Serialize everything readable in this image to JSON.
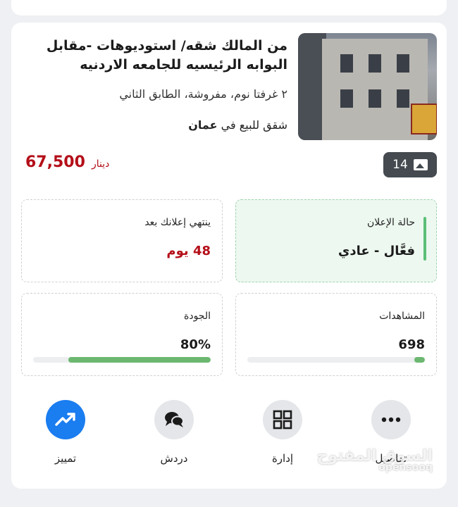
{
  "listing": {
    "title": "من المالك شقه/ استوديوهات -مقابل البوابه الرئيسيه للجامعه الاردنيه",
    "subtitle": "٢ غرفتا نوم، مفروشة، الطابق الثاني",
    "location_prefix": "شقق للبيع في",
    "location_city": "عمان",
    "price": "67,500",
    "currency": "دينار",
    "photo_count": "14"
  },
  "stats": {
    "status_label": "حالة الإعلان",
    "status_value": "فعَّال - عادي",
    "expiry_label": "ينتهي إعلانك بعد",
    "expiry_value": "48 يوم",
    "views_label": "المشاهدات",
    "views_value": "698",
    "views_fill": 0.06,
    "quality_label": "الجودة",
    "quality_value": "80%",
    "quality_fill": 0.8
  },
  "actions": [
    {
      "label": "تمييز",
      "icon": "trending-up-icon"
    },
    {
      "label": "دردش",
      "icon": "chat-icon"
    },
    {
      "label": "إدارة",
      "icon": "grid-icon"
    },
    {
      "label": "تفاصيل",
      "icon": "more-icon"
    }
  ],
  "watermark": {
    "arabic": "السوق المفتوح",
    "english": "opensooq"
  },
  "colors": {
    "price": "#b40f19",
    "accent_green": "#5bbf76",
    "primary_blue": "#1a7df0"
  }
}
